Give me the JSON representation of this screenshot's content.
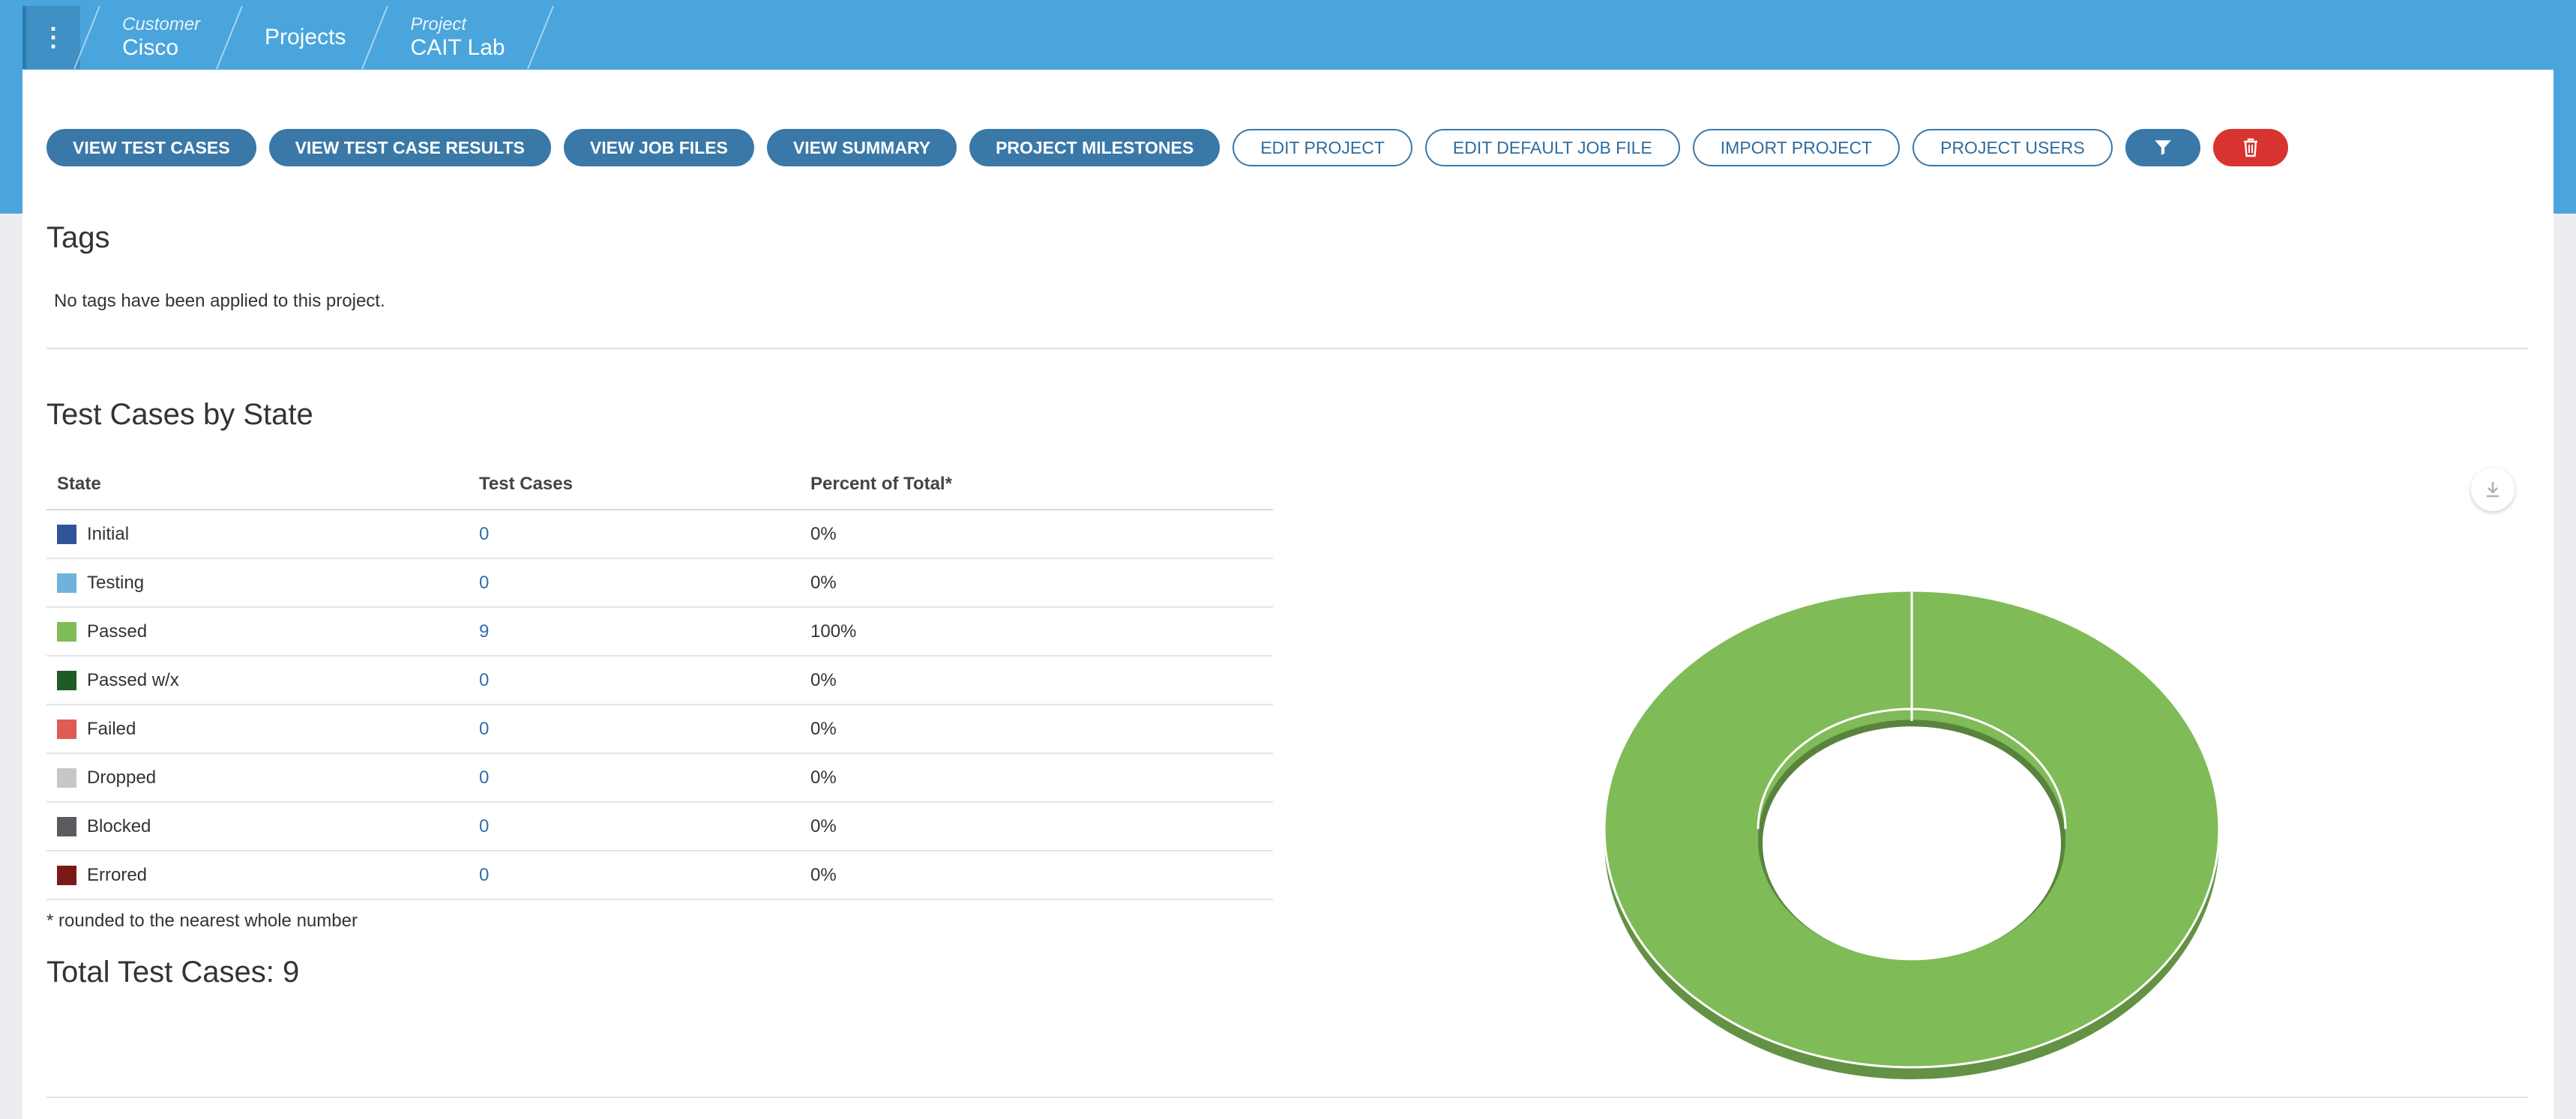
{
  "breadcrumb": {
    "customer_caption": "Customer",
    "customer_name": "Cisco",
    "projects_label": "Projects",
    "project_caption": "Project",
    "project_name": "CAIT Lab"
  },
  "toolbar": {
    "view_test_cases": "VIEW TEST CASES",
    "view_test_case_results": "VIEW TEST CASE RESULTS",
    "view_job_files": "VIEW JOB FILES",
    "view_summary": "VIEW SUMMARY",
    "project_milestones": "PROJECT MILESTONES",
    "edit_project": "EDIT PROJECT",
    "edit_default_job_file": "EDIT DEFAULT JOB FILE",
    "import_project": "IMPORT PROJECT",
    "project_users": "PROJECT USERS",
    "filter_icon": "filter-icon",
    "delete_icon": "trash-icon"
  },
  "tags": {
    "title": "Tags",
    "empty_text": "No tags have been applied to this project."
  },
  "states_section": {
    "title": "Test Cases by State",
    "columns": [
      "State",
      "Test Cases",
      "Percent of Total*"
    ],
    "rows": [
      {
        "state": "Initial",
        "count": "0",
        "percent": "0%",
        "color": "#2f5597"
      },
      {
        "state": "Testing",
        "count": "0",
        "percent": "0%",
        "color": "#6fb3dc"
      },
      {
        "state": "Passed",
        "count": "9",
        "percent": "100%",
        "color": "#7fbb57"
      },
      {
        "state": "Passed w/x",
        "count": "0",
        "percent": "0%",
        "color": "#205a25"
      },
      {
        "state": "Failed",
        "count": "0",
        "percent": "0%",
        "color": "#e05a56"
      },
      {
        "state": "Dropped",
        "count": "0",
        "percent": "0%",
        "color": "#c5c7c9"
      },
      {
        "state": "Blocked",
        "count": "0",
        "percent": "0%",
        "color": "#5a5b5e"
      },
      {
        "state": "Errored",
        "count": "0",
        "percent": "0%",
        "color": "#7b1a14"
      }
    ],
    "footnote": "* rounded to the nearest whole number",
    "total_label": "Total Test Cases: 9",
    "download_icon": "download-icon"
  },
  "chart_data": {
    "type": "pie",
    "categories": [
      "Initial",
      "Testing",
      "Passed",
      "Passed w/x",
      "Failed",
      "Dropped",
      "Blocked",
      "Errored"
    ],
    "values": [
      0,
      0,
      9,
      0,
      0,
      0,
      0,
      0
    ],
    "colors": [
      "#2f5597",
      "#6fb3dc",
      "#7fbb57",
      "#205a25",
      "#e05a56",
      "#c5c7c9",
      "#5a5b5e",
      "#7b1a14"
    ],
    "style": "3d-donut"
  }
}
